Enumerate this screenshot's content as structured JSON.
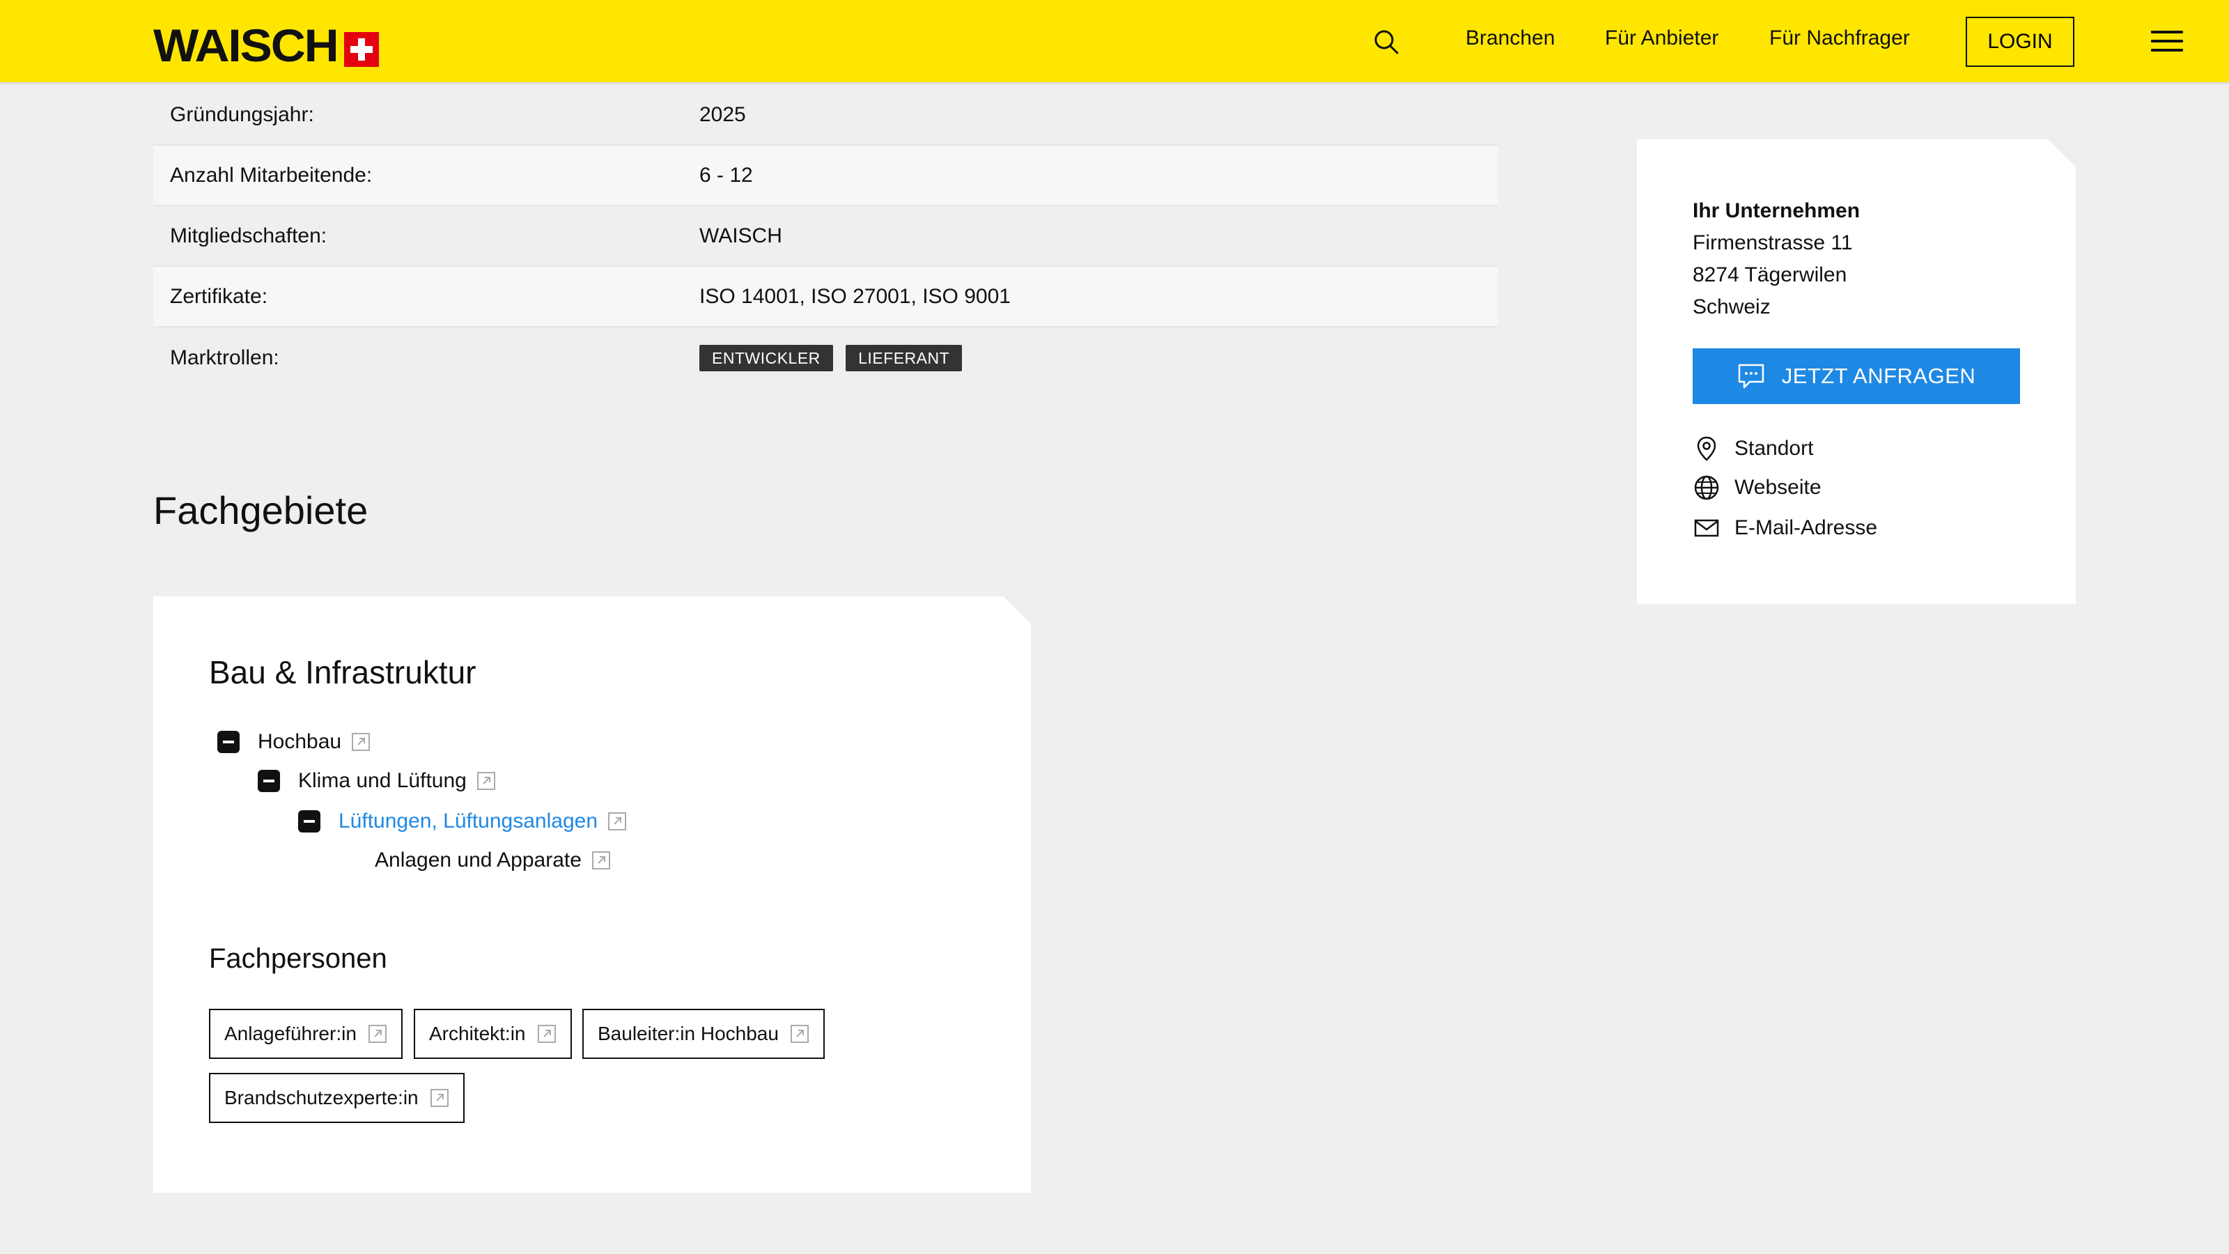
{
  "header": {
    "logo_text": "WAISCH",
    "nav": [
      "Branchen",
      "Für Anbieter",
      "Für Nachfrager"
    ],
    "login_label": "LOGIN"
  },
  "details": {
    "rows": [
      {
        "label": "Gründungsjahr:",
        "value": "2025"
      },
      {
        "label": "Anzahl Mitarbeitende:",
        "value": "6 - 12"
      },
      {
        "label": "Mitgliedschaften:",
        "value": "WAISCH"
      },
      {
        "label": "Zertifikate:",
        "value": "ISO 14001, ISO 27001, ISO 9001"
      },
      {
        "label": "Marktrollen:",
        "value": ""
      }
    ],
    "market_roles": [
      "ENTWICKLER",
      "LIEFERANT"
    ]
  },
  "sidebar": {
    "company_name": "Ihr Unternehmen",
    "street": "Firmenstrasse 11",
    "city": "8274 Tägerwilen",
    "country": "Schweiz",
    "cta_label": "JETZT ANFRAGEN",
    "links": [
      "Standort",
      "Webseite",
      "E-Mail-Adresse"
    ]
  },
  "fachgebiete": {
    "title": "Fachgebiete",
    "category": "Bau & Infrastruktur",
    "tree": [
      "Hochbau",
      "Klima und Lüftung",
      "Lüftungen, Lüftungsanlagen",
      "Anlagen und Apparate"
    ],
    "persons_title": "Fachpersonen",
    "persons": [
      "Anlageführer:in",
      "Architekt:in",
      "Bauleiter:in Hochbau",
      "Brandschutzexperte:in"
    ]
  },
  "colors": {
    "header_bg": "#ffe600",
    "accent_blue": "#1e88e5",
    "badge_bg": "#333333",
    "flag_red": "#e3000f"
  }
}
